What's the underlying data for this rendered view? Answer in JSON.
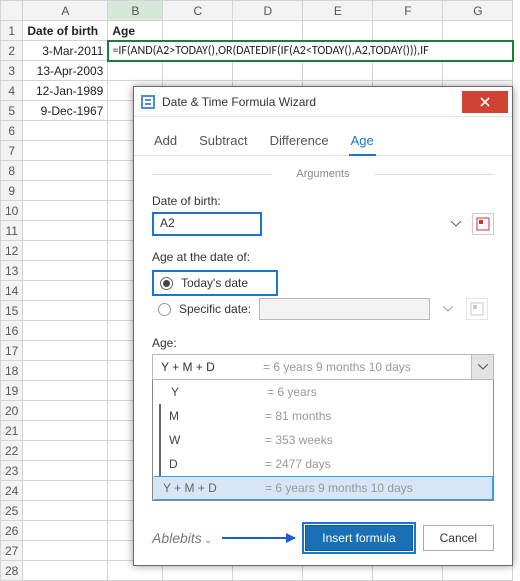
{
  "columns": [
    "A",
    "B",
    "C",
    "D",
    "E",
    "F",
    "G"
  ],
  "rows": [
    "1",
    "2",
    "3",
    "4",
    "5",
    "6",
    "7",
    "8",
    "9",
    "10",
    "11",
    "12",
    "13",
    "14",
    "15",
    "16",
    "17",
    "18",
    "19",
    "20",
    "21",
    "22",
    "23",
    "24",
    "25",
    "26",
    "27",
    "28"
  ],
  "headers": {
    "A1": "Date of birth",
    "B1": "Age"
  },
  "cells": {
    "A2": "3-Mar-2011",
    "A3": "13-Apr-2003",
    "A4": "12-Jan-1989",
    "A5": "9-Dec-1967",
    "B2_formula": "=IF(AND(A2>TODAY(),OR(DATEDIF(IF(A2<TODAY(),A2,TODAY())),IF"
  },
  "dialog": {
    "title": "Date & Time Formula Wizard",
    "tabs": [
      "Add",
      "Subtract",
      "Difference",
      "Age"
    ],
    "active_tab": "Age",
    "arguments_label": "Arguments",
    "dob_label": "Date of birth:",
    "dob_value": "A2",
    "age_at_label": "Age at the date of:",
    "radio_today": "Today's date",
    "radio_specific": "Specific date:",
    "age_label": "Age:",
    "selected_format": {
      "code": "Y + M + D",
      "example": "= 6 years 9 months 10 days"
    },
    "options": [
      {
        "code": "Y",
        "example": "= 6 years"
      },
      {
        "code": "M",
        "example": "= 81 months"
      },
      {
        "code": "W",
        "example": "= 353 weeks"
      },
      {
        "code": "D",
        "example": "= 2477 days"
      },
      {
        "code": "Y + M + D",
        "example": "= 6 years 9 months 10 days"
      }
    ],
    "brand": "Ablebits",
    "insert_btn": "Insert formula",
    "cancel_btn": "Cancel"
  }
}
